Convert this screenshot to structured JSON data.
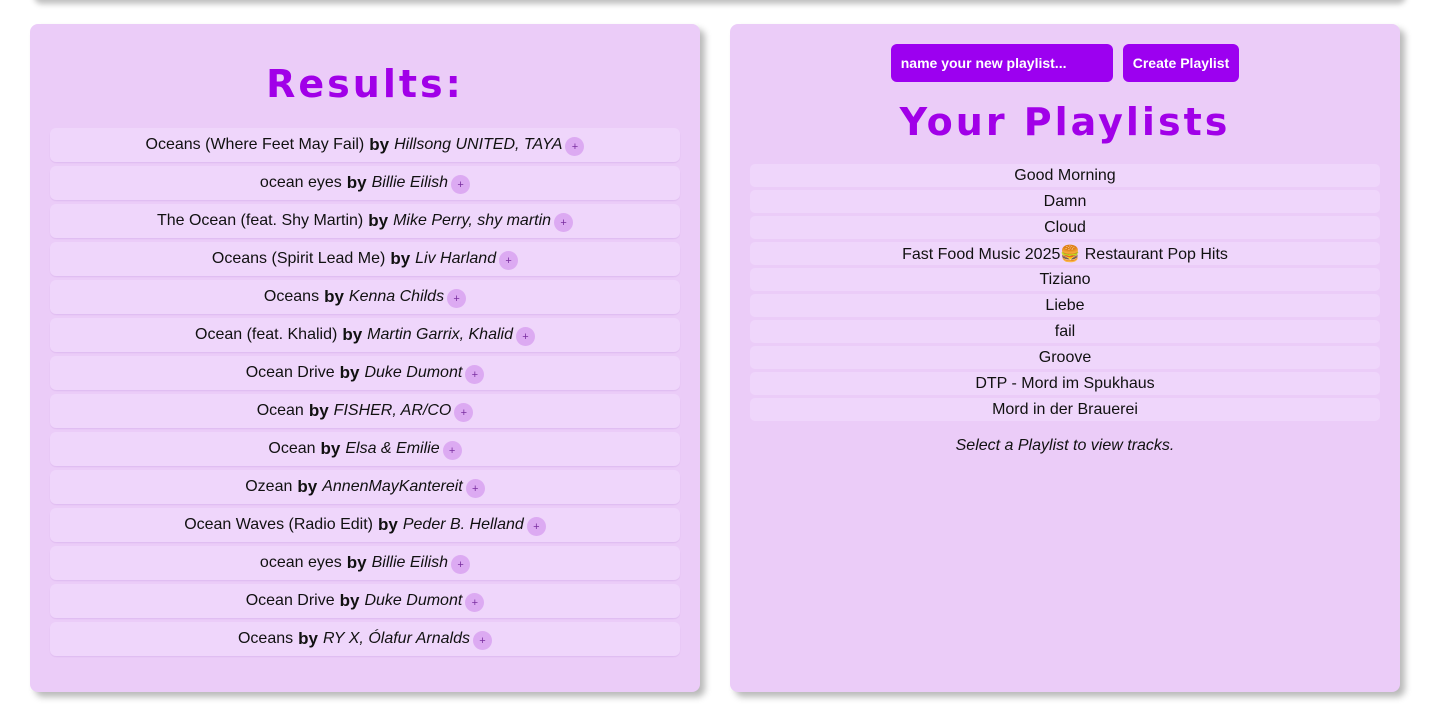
{
  "results": {
    "title": "Results:",
    "by_label": "by",
    "add_label": "+",
    "tracks": [
      {
        "title": "Oceans (Where Feet May Fail)",
        "artist": "Hillsong UNITED, TAYA"
      },
      {
        "title": "ocean eyes",
        "artist": "Billie Eilish"
      },
      {
        "title": "The Ocean (feat. Shy Martin)",
        "artist": "Mike Perry, shy martin"
      },
      {
        "title": "Oceans (Spirit Lead Me)",
        "artist": "Liv Harland"
      },
      {
        "title": "Oceans",
        "artist": "Kenna Childs"
      },
      {
        "title": "Ocean (feat. Khalid)",
        "artist": "Martin Garrix, Khalid"
      },
      {
        "title": "Ocean Drive",
        "artist": "Duke Dumont"
      },
      {
        "title": "Ocean",
        "artist": "FISHER, AR/CO"
      },
      {
        "title": "Ocean",
        "artist": "Elsa & Emilie"
      },
      {
        "title": "Ozean",
        "artist": "AnnenMayKantereit"
      },
      {
        "title": "Ocean Waves (Radio Edit)",
        "artist": "Peder B. Helland"
      },
      {
        "title": "ocean eyes",
        "artist": "Billie Eilish"
      },
      {
        "title": "Ocean Drive",
        "artist": "Duke Dumont"
      },
      {
        "title": "Oceans",
        "artist": "RY X, Ólafur Arnalds"
      }
    ]
  },
  "playlists": {
    "input_placeholder": "name your new playlist...",
    "create_label": "Create Playlist",
    "title": "Your Playlists",
    "items": [
      "Good Morning",
      "Damn",
      "Cloud",
      "Fast Food Music 2025🍔 Restaurant Pop Hits",
      "Tiziano",
      "Liebe",
      "fail",
      "Groove",
      "DTP - Mord im Spukhaus",
      "Mord in der Brauerei"
    ],
    "hint": "Select a Playlist to view tracks."
  },
  "colors": {
    "panel_bg": "#ebccf8",
    "row_bg": "#efd6fb",
    "accent": "#9c00f0",
    "title": "#a100e8"
  }
}
